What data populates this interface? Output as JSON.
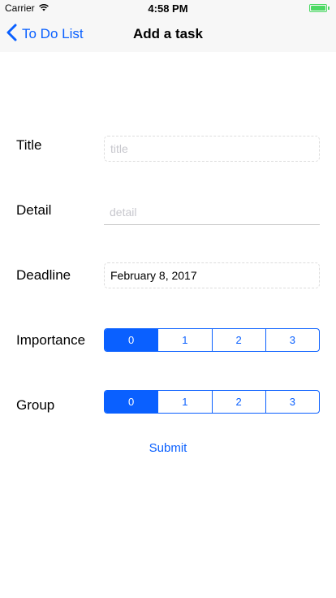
{
  "status_bar": {
    "carrier": "Carrier",
    "time": "4:58 PM",
    "icons": [
      "wifi-icon",
      "battery-icon"
    ],
    "battery_level": 1.0
  },
  "nav": {
    "back_label": "To Do List",
    "title": "Add a task"
  },
  "form": {
    "title_label": "Title",
    "title_placeholder": "title",
    "detail_label": "Detail",
    "detail_placeholder": "detail",
    "deadline_label": "Deadline",
    "deadline_value": "February 8, 2017",
    "importance_label": "Importance",
    "importance_options": [
      "0",
      "1",
      "2",
      "3"
    ],
    "importance_selected": "0",
    "group_label": "Group",
    "group_options": [
      "0",
      "1",
      "2",
      "3"
    ],
    "group_selected": "0",
    "submit_label": "Submit"
  },
  "colors": {
    "accent": "#0a60ff",
    "battery": "#4cd964",
    "bar_background": "#f7f7f7"
  }
}
